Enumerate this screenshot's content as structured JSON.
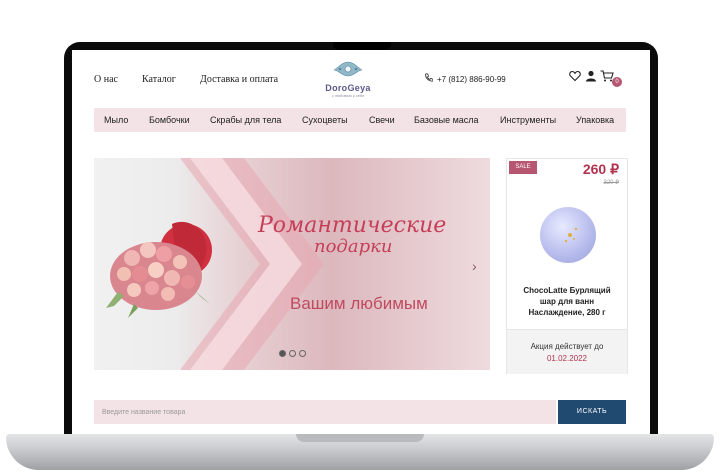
{
  "header": {
    "nav": [
      "О нас",
      "Каталог",
      "Доставка и оплата"
    ],
    "logo_text": "DoroGeya",
    "logo_sub": "с любовью к себе",
    "phone": "+7 (812) 886-90-99",
    "cart_count": "0"
  },
  "categories": [
    "Мыло",
    "Бомбочки",
    "Скрабы для тела",
    "Сухоцветы",
    "Свечи",
    "Базовые масла",
    "Инструменты",
    "Упаковка"
  ],
  "banner": {
    "title_line1": "Романтические",
    "title_line2": "подарки",
    "subtitle": "Вашим любимым",
    "active_slide": 1,
    "slides_total": 3
  },
  "sale_card": {
    "badge": "SALE",
    "price": "260 ₽",
    "old_price": "320 ₽",
    "name": "ChocoLatte Бурлящий шар для ванн Наслаждение, 280 г",
    "promo_text": "Акция действует до",
    "promo_date": "01.02.2022"
  },
  "search": {
    "placeholder": "Введите название товара",
    "button_label": "ИСКАТЬ"
  },
  "colors": {
    "accent": "#b2334f",
    "banner_text": "#c53f58",
    "category_bar": "#f3e3e6",
    "search_button": "#214a70"
  },
  "icons": [
    "phone-icon",
    "heart-icon",
    "user-icon",
    "cart-icon",
    "chevron-right-icon"
  ]
}
